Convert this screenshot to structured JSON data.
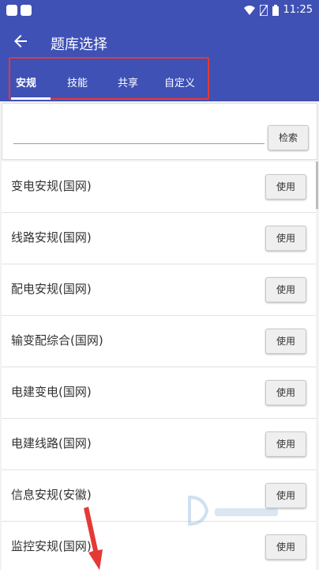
{
  "status_bar": {
    "time": "11:25"
  },
  "header": {
    "title": "题库选择"
  },
  "tabs": [
    {
      "label": "安规",
      "active": true
    },
    {
      "label": "技能",
      "active": false
    },
    {
      "label": "共享",
      "active": false
    },
    {
      "label": "自定义",
      "active": false
    }
  ],
  "search": {
    "value": "",
    "placeholder": "",
    "button_label": "检索"
  },
  "items": [
    {
      "label": "变电安规(国网)",
      "button_label": "使用"
    },
    {
      "label": "线路安规(国网)",
      "button_label": "使用"
    },
    {
      "label": "配电安规(国网)",
      "button_label": "使用"
    },
    {
      "label": "输变配综合(国网)",
      "button_label": "使用"
    },
    {
      "label": "电建变电(国网)",
      "button_label": "使用"
    },
    {
      "label": "电建线路(国网)",
      "button_label": "使用"
    },
    {
      "label": "信息安规(安徽)",
      "button_label": "使用"
    },
    {
      "label": "监控安规(国网)",
      "button_label": "使用"
    }
  ],
  "colors": {
    "primary": "#3f51b5",
    "highlight_box": "#e53935"
  }
}
